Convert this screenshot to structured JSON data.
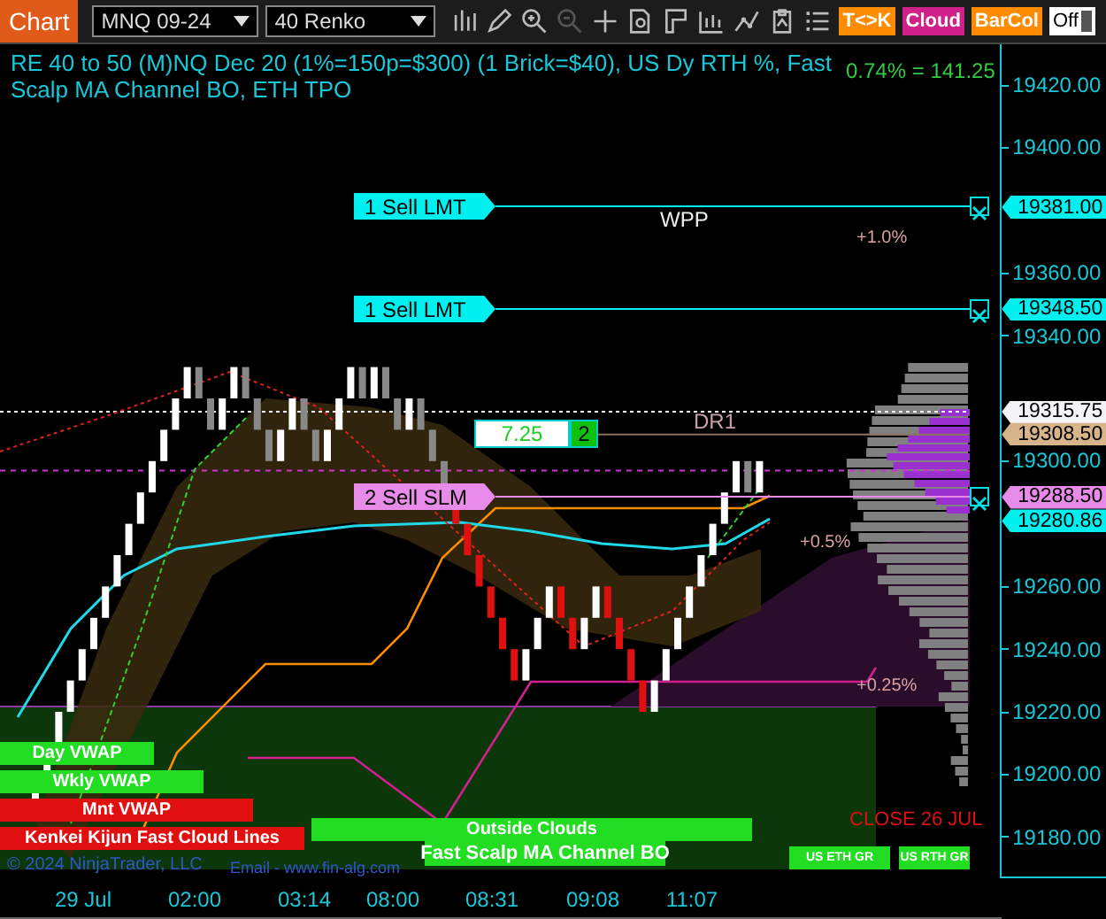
{
  "toolbar": {
    "chart_tab": "Chart",
    "instrument": "MNQ 09-24",
    "bar_type": "40 Renko",
    "toggles": [
      {
        "label": "T<>K",
        "color": "#ff8c00"
      },
      {
        "label": "Cloud",
        "color": "#d0208a"
      },
      {
        "label": "BarCol",
        "color": "#ff8c00"
      }
    ],
    "mode_select": "Off"
  },
  "chart": {
    "title": "RE 40 to 50 (M)NQ Dec 20 (1%=150p=$300) (1 Brick=$40), US Dy RTH %, Fast Scalp MA Channel BO, ETH TPO",
    "range_readout": "0.74% = 141.25",
    "orders": [
      {
        "label": "1 Sell LMT",
        "kind": "limit"
      },
      {
        "label": "1 Sell LMT",
        "kind": "limit"
      },
      {
        "label": "2 Sell SLM",
        "kind": "stop"
      }
    ],
    "position": {
      "pnl": "7.25",
      "quantity": "2"
    },
    "level_labels": [
      "WPP",
      "DR1",
      "+1.0%",
      "+0.5%",
      "+0.25%"
    ],
    "bands": [
      {
        "label": "Day VWAP",
        "color": "#22dd22"
      },
      {
        "label": "Wkly VWAP",
        "color": "#22dd22"
      },
      {
        "label": "Mnt VWAP",
        "color": "#e01010"
      },
      {
        "label": "Kenkei Kijun Fast Cloud Lines",
        "color": "#e01010"
      },
      {
        "label": "Outside Clouds",
        "color": "#22dd22"
      },
      {
        "label": "Fast Scalp MA Channel BO",
        "color": "#22dd22"
      },
      {
        "label": "US ETH GR",
        "color": "#22dd22"
      },
      {
        "label": "US RTH GR",
        "color": "#22dd22"
      }
    ],
    "close_label": "CLOSE 26 JUL",
    "copyright": "© 2024 NinjaTrader, LLC",
    "email": "Email - www.fin-alg.com"
  },
  "price_axis": {
    "ticks": [
      "19420.00",
      "19400.00",
      "19360.00",
      "19340.00",
      "19300.00",
      "19260.00",
      "19240.00",
      "19220.00",
      "19200.00",
      "19180.00"
    ],
    "flags": [
      {
        "text": "19381.00",
        "color": "#00f0f0"
      },
      {
        "text": "19348.50",
        "color": "#00f0f0"
      },
      {
        "text": "19315.75",
        "color": "#f4f4f8"
      },
      {
        "text": "19308.50",
        "color": "#d8b48a"
      },
      {
        "text": "19288.50",
        "color": "#e88ae8"
      },
      {
        "text": "19280.86",
        "color": "#00f0f0"
      }
    ]
  },
  "time_axis": {
    "labels": [
      "29 Jul",
      "02:00",
      "03:14",
      "08:00",
      "08:31",
      "09:08",
      "11:07"
    ]
  }
}
